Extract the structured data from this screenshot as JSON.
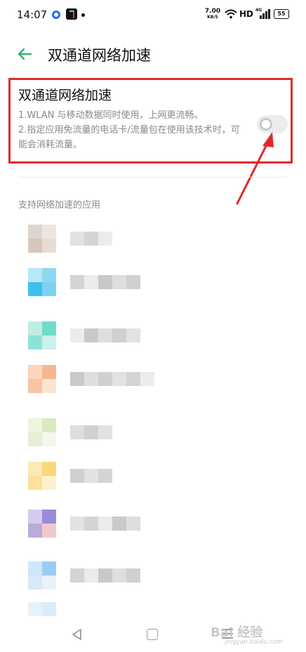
{
  "status_bar": {
    "time": "14:07",
    "net_speed": "7.00",
    "net_speed_unit": "KB/S",
    "hd_label": "HD",
    "signal_label": "4G",
    "battery": "55"
  },
  "header": {
    "title": "双通道网络加速"
  },
  "setting": {
    "title": "双通道网络加速",
    "description_1": "1.WLAN 与移动数据同时使用，上网更流畅。",
    "description_2": "2.指定应用免流量的电话卡/流量包在使用该技术时，可能会消耗流量。",
    "enabled": false
  },
  "apps_section": {
    "label": "支持网络加速的应用"
  },
  "watermark": {
    "brand": "Bai 经验",
    "sub": "jingyan.baidu.com"
  },
  "colors": {
    "accent_green": "#2bb673",
    "highlight_red": "#e12a2a",
    "secondary_text": "#8a8a8a"
  }
}
